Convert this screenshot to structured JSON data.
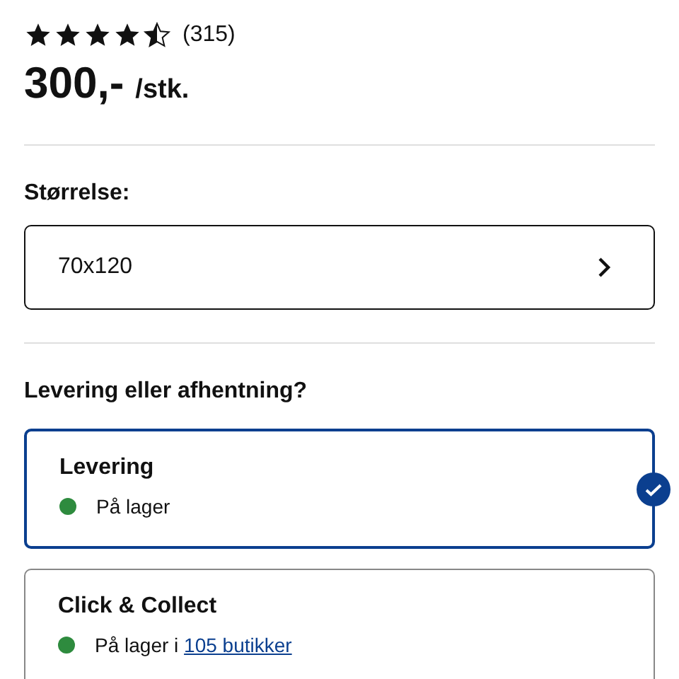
{
  "rating": {
    "stars": 4.5,
    "count": "(315)"
  },
  "price": {
    "amount": "300,-",
    "unit": "/stk."
  },
  "size": {
    "label": "Størrelse:",
    "value": "70x120"
  },
  "delivery": {
    "heading": "Levering eller afhentning?",
    "options": [
      {
        "title": "Levering",
        "selected": true,
        "status": "På lager",
        "color": "#2e8b3e"
      },
      {
        "title": "Click & Collect",
        "selected": false,
        "status": "På lager i",
        "link": "105 butikker",
        "color": "#2e8b3e"
      }
    ]
  }
}
